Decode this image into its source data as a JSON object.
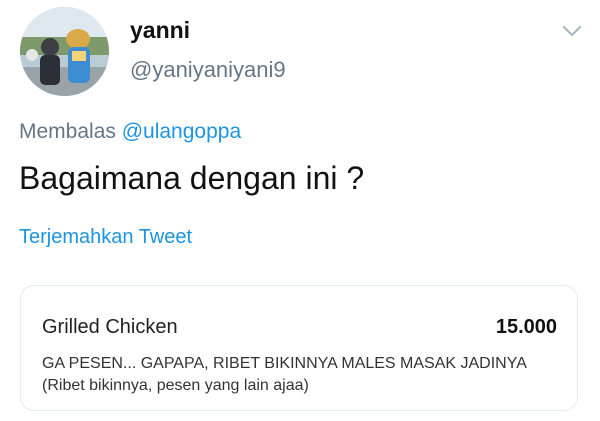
{
  "user": {
    "display_name": "yanni",
    "handle": "@yaniyaniyani9",
    "avatar": "avatar-photo"
  },
  "menu": {
    "icon": "chevron-down-icon",
    "color": "#aab8c2"
  },
  "reply": {
    "prefix": "Membalas",
    "mention": "@ulangoppa"
  },
  "tweet": {
    "text": "Bagaimana dengan ini ?",
    "translate_label": "Terjemahkan Tweet"
  },
  "order_card": {
    "item_name": "Grilled Chicken",
    "price": "15.000",
    "note": "GA PESEN... GAPAPA, RIBET BIKINNYA MALES MASAK JADINYA (Ribet bikinnya, pesen yang lain ajaa)"
  },
  "colors": {
    "link": "#1b95e0",
    "secondary_text": "#657786",
    "card_border": "#e6ecf0"
  }
}
